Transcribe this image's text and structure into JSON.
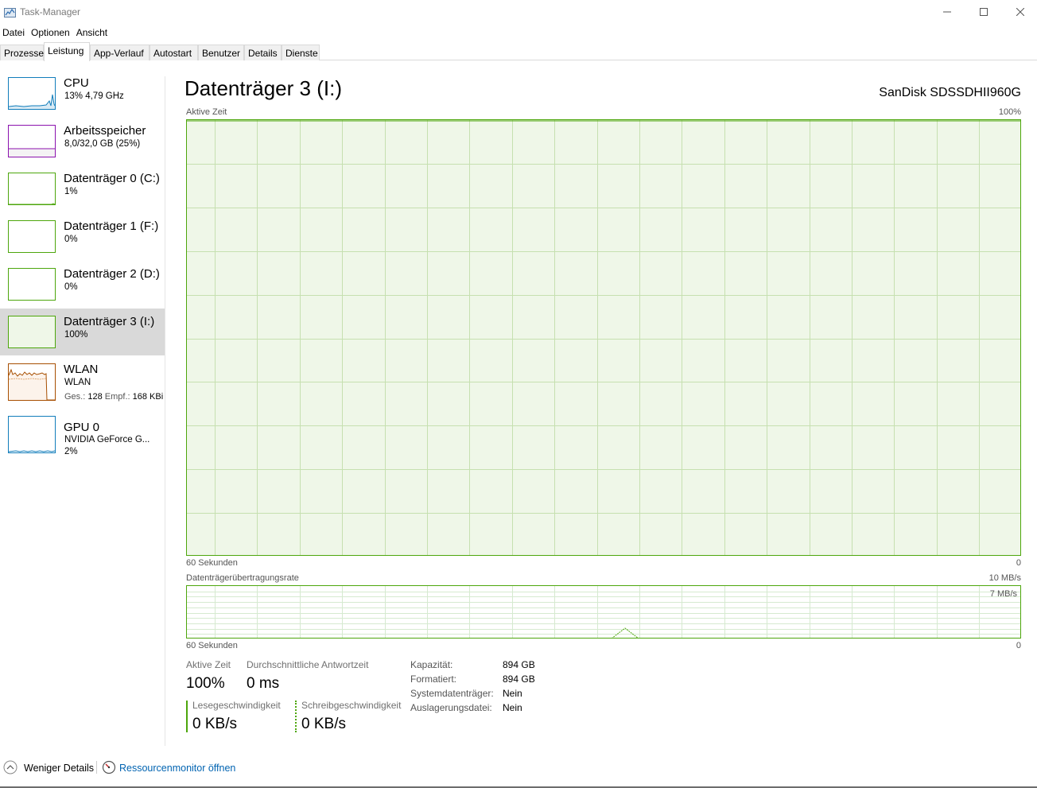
{
  "window": {
    "title": "Task-Manager",
    "minimize_icon": "minimize-icon",
    "maximize_icon": "maximize-icon",
    "close_icon": "close-icon"
  },
  "menu": [
    "Datei",
    "Optionen",
    "Ansicht"
  ],
  "tabs": [
    "Prozesse",
    "Leistung",
    "App-Verlauf",
    "Autostart",
    "Benutzer",
    "Details",
    "Dienste"
  ],
  "active_tab": "Leistung",
  "devices": [
    {
      "name": "CPU",
      "sub": "13% 4,79 GHz",
      "color": "#117dbb",
      "fill": "#f1f6fa"
    },
    {
      "name": "Arbeitsspeicher",
      "sub": "8,0/32,0 GB (25%)",
      "color": "#8b12ae",
      "fill": "#f4f2f4"
    },
    {
      "name": "Datenträger 0 (C:)",
      "sub": "1%",
      "color": "#4da60c",
      "fill": "#eff7e8"
    },
    {
      "name": "Datenträger 1 (F:)",
      "sub": "0%",
      "color": "#4da60c",
      "fill": "#eff7e8"
    },
    {
      "name": "Datenträger 2 (D:)",
      "sub": "0%",
      "color": "#4da60c",
      "fill": "#eff7e8"
    },
    {
      "name": "Datenträger 3 (I:)",
      "sub": "100%",
      "color": "#4da60c",
      "fill": "#eff7e8"
    },
    {
      "name": "WLAN",
      "sub": "WLAN",
      "sub2_label1": "Ges.:",
      "sub2_val1": "128",
      "sub2_label2": "Empf.:",
      "sub2_val2": "168 KBi",
      "color": "#a74f01",
      "fill": "#fcf3eb"
    },
    {
      "name": "GPU 0",
      "sub": "NVIDIA GeForce G...",
      "sub3": "2%",
      "color": "#117dbb",
      "fill": "#f1f6fa"
    }
  ],
  "selected_device_index": 5,
  "main": {
    "title": "Datenträger 3 (I:)",
    "model": "SanDisk SDSSDHII960G",
    "active_time_graph": {
      "label": "Aktive Zeit",
      "max_label": "100%",
      "x_left": "60 Sekunden",
      "x_right": "0",
      "value_percent": 100
    },
    "transfer_graph": {
      "label": "Datenträgerübertragungsrate",
      "max_label": "10 MB/s",
      "inner_label": "7 MB/s",
      "x_left": "60 Sekunden",
      "x_right": "0"
    },
    "stats": {
      "active_time_label": "Aktive Zeit",
      "active_time_value": "100%",
      "avg_response_label": "Durchschnittliche Antwortzeit",
      "avg_response_value": "0 ms",
      "read_speed_label": "Lesegeschwindigkeit",
      "read_speed_value": "0 KB/s",
      "write_speed_label": "Schreibgeschwindigkeit",
      "write_speed_value": "0 KB/s"
    },
    "properties": [
      {
        "label": "Kapazität:",
        "value": "894 GB"
      },
      {
        "label": "Formatiert:",
        "value": "894 GB"
      },
      {
        "label": "Systemdatenträger:",
        "value": "Nein"
      },
      {
        "label": "Auslagerungsdatei:",
        "value": "Nein"
      }
    ]
  },
  "footer": {
    "less_details": "Weniger Details",
    "resource_monitor": "Ressourcenmonitor öffnen",
    "link_color": "#0063b1"
  }
}
